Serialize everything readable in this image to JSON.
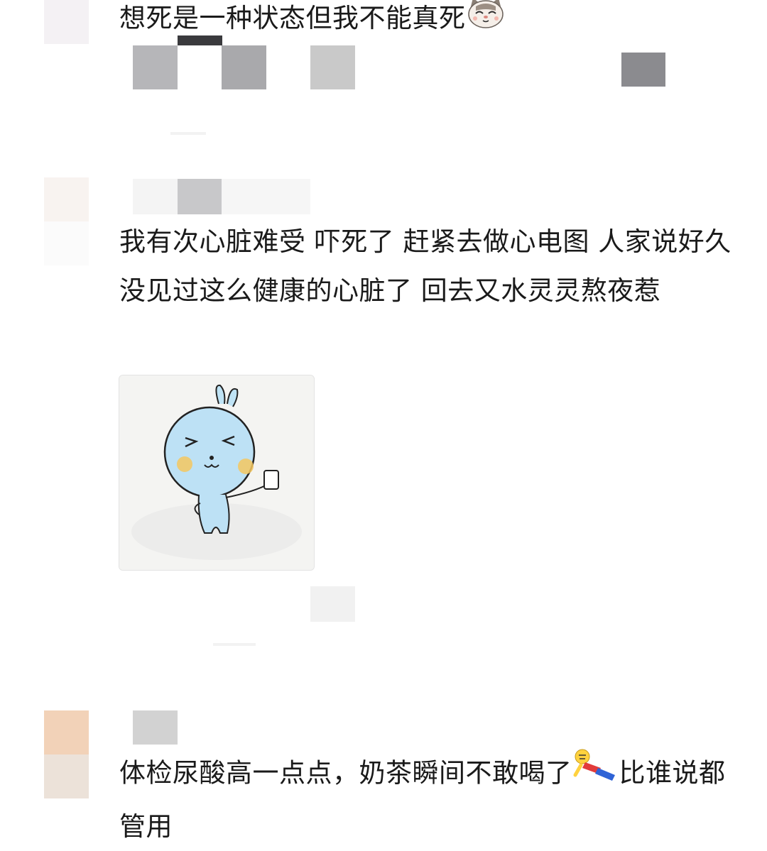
{
  "comments": [
    {
      "text": "想死是一种状态但我不能真死",
      "emoji": "cat-face-emoji"
    },
    {
      "text": "我有次心脏难受 吓死了 赶紧去做心电图 人家说好久没见过这么健康的心脏了 回去又水灵灵熬夜惹",
      "sticker": "blue-bunny-toast-sticker"
    },
    {
      "text_before": "体检尿酸高一点点，奶茶瞬间不敢喝了",
      "emoji": "falling-person-emoji",
      "text_after": "比谁说都管用"
    }
  ],
  "colors": {
    "text": "#1a1a1a",
    "avatar_peach": "#f2d2b8",
    "avatar_beige": "#ece2d9",
    "mosaic_gray": "#a9a9ad"
  }
}
